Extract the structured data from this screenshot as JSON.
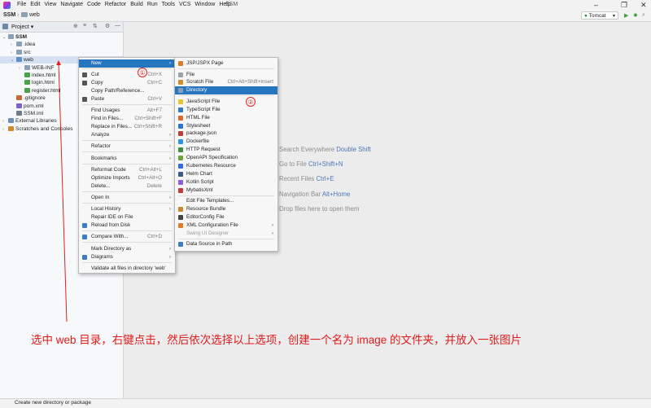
{
  "menubar": {
    "items": [
      "File",
      "Edit",
      "View",
      "Navigate",
      "Code",
      "Refactor",
      "Build",
      "Run",
      "Tools",
      "VCS",
      "Window",
      "Help"
    ],
    "project_title": "SSM",
    "window_controls": [
      "–",
      "❐",
      "✕"
    ]
  },
  "navbar": {
    "breadcrumb_project": "SSM",
    "breadcrumb_folder": "web",
    "run_config": "Tomcat"
  },
  "project_panel": {
    "title": "Project",
    "tree": [
      {
        "label": "SSM",
        "depth": 0,
        "expanded": true,
        "icon": "folder-icon"
      },
      {
        "label": ".idea",
        "depth": 1,
        "expanded": false,
        "icon": "folder-icon"
      },
      {
        "label": "src",
        "depth": 1,
        "expanded": false,
        "icon": "folder-icon"
      },
      {
        "label": "web",
        "depth": 1,
        "expanded": true,
        "icon": "web-folder-icon",
        "selected": true
      },
      {
        "label": "WEB-INF",
        "depth": 2,
        "expanded": false,
        "icon": "folder-icon"
      },
      {
        "label": "index.html",
        "depth": 2,
        "icon": "html-file-icon"
      },
      {
        "label": "login.html",
        "depth": 2,
        "icon": "html-file-icon"
      },
      {
        "label": "register.html",
        "depth": 2,
        "icon": "html-file-icon"
      },
      {
        "label": ".gitignore",
        "depth": 1,
        "icon": "gitignore-icon"
      },
      {
        "label": "pom.xml",
        "depth": 1,
        "icon": "maven-icon"
      },
      {
        "label": "SSM.iml",
        "depth": 1,
        "icon": "module-file-icon"
      },
      {
        "label": "External Libraries",
        "depth": 0,
        "expanded": false,
        "icon": "library-icon"
      },
      {
        "label": "Scratches and Consoles",
        "depth": 0,
        "expanded": false,
        "icon": "scratch-icon"
      }
    ]
  },
  "context_menu": {
    "items": [
      {
        "label": "New",
        "shortcut": "",
        "submenu": true,
        "selected": true,
        "icon": ""
      },
      {
        "sep": true
      },
      {
        "label": "Cut",
        "shortcut": "Ctrl+X",
        "icon": "cut-icon"
      },
      {
        "label": "Copy",
        "shortcut": "Ctrl+C",
        "icon": "copy-icon"
      },
      {
        "label": "Copy Path/Reference...",
        "shortcut": "",
        "icon": ""
      },
      {
        "label": "Paste",
        "shortcut": "Ctrl+V",
        "icon": "paste-icon"
      },
      {
        "sep": true
      },
      {
        "label": "Find Usages",
        "shortcut": "Alt+F7",
        "icon": ""
      },
      {
        "label": "Find in Files...",
        "shortcut": "Ctrl+Shift+F",
        "icon": ""
      },
      {
        "label": "Replace in Files...",
        "shortcut": "Ctrl+Shift+R",
        "icon": ""
      },
      {
        "label": "Analyze",
        "shortcut": "",
        "submenu": true,
        "icon": ""
      },
      {
        "sep": true
      },
      {
        "label": "Refactor",
        "shortcut": "",
        "submenu": true,
        "icon": ""
      },
      {
        "sep": true
      },
      {
        "label": "Bookmarks",
        "shortcut": "",
        "submenu": true,
        "icon": ""
      },
      {
        "sep": true
      },
      {
        "label": "Reformat Code",
        "shortcut": "Ctrl+Alt+L",
        "icon": ""
      },
      {
        "label": "Optimize Imports",
        "shortcut": "Ctrl+Alt+O",
        "icon": ""
      },
      {
        "label": "Delete...",
        "shortcut": "Delete",
        "icon": ""
      },
      {
        "sep": true
      },
      {
        "label": "Open In",
        "shortcut": "",
        "submenu": true,
        "icon": ""
      },
      {
        "sep": true
      },
      {
        "label": "Local History",
        "shortcut": "",
        "submenu": true,
        "icon": ""
      },
      {
        "label": "Repair IDE on File",
        "shortcut": "",
        "icon": ""
      },
      {
        "label": "Reload from Disk",
        "shortcut": "",
        "icon": "reload-icon"
      },
      {
        "sep": true
      },
      {
        "label": "Compare With...",
        "shortcut": "Ctrl+D",
        "icon": "compare-icon"
      },
      {
        "sep": true
      },
      {
        "label": "Mark Directory as",
        "shortcut": "",
        "submenu": true,
        "icon": ""
      },
      {
        "label": "Diagrams",
        "shortcut": "",
        "submenu": true,
        "icon": "diagram-icon"
      },
      {
        "sep": true
      },
      {
        "label": "Validate all files in directory 'web'",
        "shortcut": "",
        "icon": ""
      }
    ]
  },
  "new_submenu": {
    "items": [
      {
        "label": "JSP/JSPX Page",
        "shortcut": "",
        "icon": "jsp-icon"
      },
      {
        "sep": true
      },
      {
        "label": "File",
        "shortcut": "",
        "icon": "file-icon"
      },
      {
        "label": "Scratch File",
        "shortcut": "Ctrl+Alt+Shift+Insert",
        "icon": "scratch-file-icon"
      },
      {
        "label": "Directory",
        "shortcut": "",
        "icon": "directory-icon",
        "selected": true
      },
      {
        "sep": true
      },
      {
        "label": "JavaScript File",
        "shortcut": "",
        "icon": "javascript-icon"
      },
      {
        "label": "TypeScript File",
        "shortcut": "",
        "icon": "typescript-icon"
      },
      {
        "label": "HTML File",
        "shortcut": "",
        "icon": "html-icon"
      },
      {
        "label": "Stylesheet",
        "shortcut": "",
        "icon": "css-icon"
      },
      {
        "label": "package.json",
        "shortcut": "",
        "icon": "npm-icon"
      },
      {
        "label": "Dockerfile",
        "shortcut": "",
        "icon": "docker-icon"
      },
      {
        "label": "HTTP Request",
        "shortcut": "",
        "icon": "http-icon"
      },
      {
        "label": "OpenAPI Specification",
        "shortcut": "",
        "icon": "openapi-icon"
      },
      {
        "label": "Kubernetes Resource",
        "shortcut": "",
        "icon": "kubernetes-icon"
      },
      {
        "label": "Helm Chart",
        "shortcut": "",
        "icon": "helm-icon"
      },
      {
        "label": "Kotlin Script",
        "shortcut": "",
        "icon": "kotlin-icon"
      },
      {
        "label": "MybatisXml",
        "shortcut": "",
        "icon": "mybatis-icon"
      },
      {
        "sep": true
      },
      {
        "label": "Edit File Templates...",
        "shortcut": "",
        "icon": ""
      },
      {
        "label": "Resource Bundle",
        "shortcut": "",
        "icon": "resource-bundle-icon"
      },
      {
        "label": "EditorConfig File",
        "shortcut": "",
        "icon": "editorconfig-icon"
      },
      {
        "label": "XML Configuration File",
        "shortcut": "",
        "submenu": true,
        "icon": "xml-icon"
      },
      {
        "label": "Swing UI Designer",
        "shortcut": "",
        "submenu": true,
        "disabled": true,
        "icon": ""
      },
      {
        "sep": true
      },
      {
        "label": "Data Source in Path",
        "shortcut": "",
        "icon": "database-icon"
      }
    ]
  },
  "editor_hints": [
    {
      "text": "Search Everywhere",
      "key": "Double Shift"
    },
    {
      "text": "Go to File",
      "key": "Ctrl+Shift+N"
    },
    {
      "text": "Recent Files",
      "key": "Ctrl+E"
    },
    {
      "text": "Navigation Bar",
      "key": "Alt+Home"
    },
    {
      "text": "Drop files here to open them",
      "key": ""
    }
  ],
  "annotations": {
    "marker_1": "①",
    "marker_2": "②",
    "caption": "选中 web 目录，右键点击，然后依次选择以上选项，创建一个名为 image 的文件夹，并放入一张图片"
  },
  "statusbar": {
    "text": "Create new directory or package"
  },
  "colors": {
    "selection": "#2675bf",
    "annotation": "#e02020",
    "hint_key": "#4a78b8"
  }
}
